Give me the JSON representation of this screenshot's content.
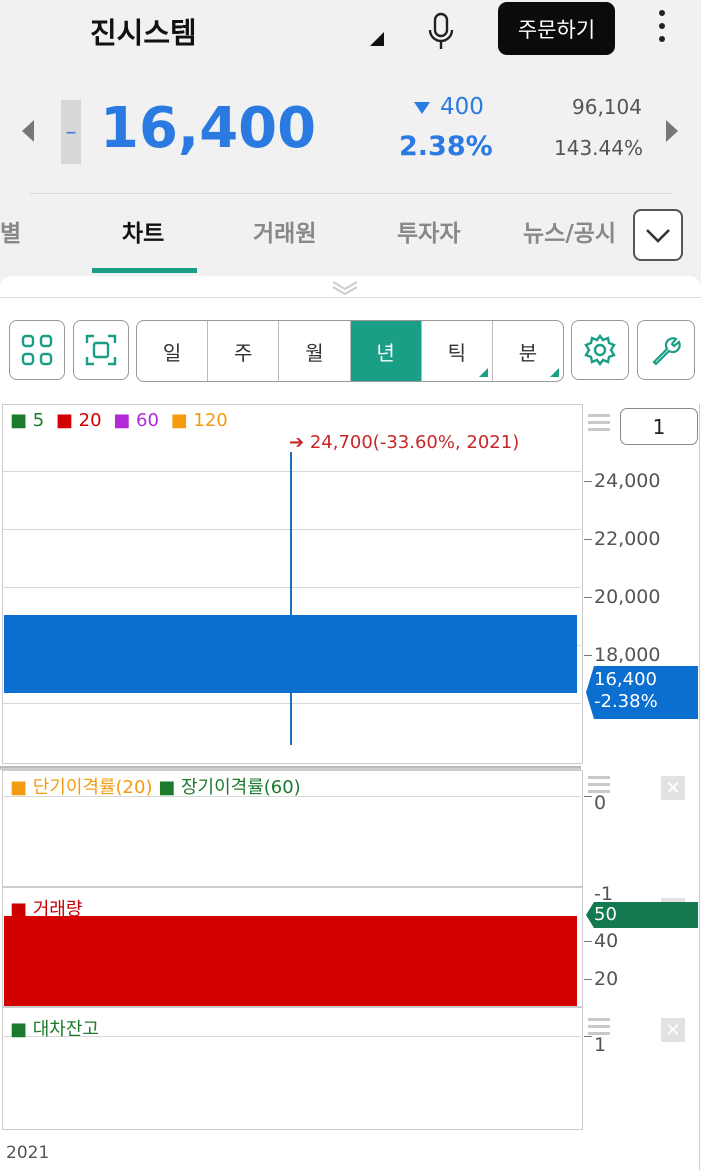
{
  "header": {
    "stock_name": "진시스템",
    "order_button": "주문하기"
  },
  "quote": {
    "flat_mark": "–",
    "price": "16,400",
    "change_amount": "400",
    "change_percent": "2.38%",
    "volume": "96,104",
    "volume_ratio": "143.44%"
  },
  "tabs": [
    "별",
    "차트",
    "거래원",
    "투자자",
    "뉴스/공시"
  ],
  "periods": [
    "일",
    "주",
    "월",
    "년",
    "틱",
    "분"
  ],
  "active_period": "년",
  "chart": {
    "legend": [
      {
        "label": "5",
        "color": "#1b7a2c"
      },
      {
        "label": "20",
        "color": "#d20000"
      },
      {
        "label": "60",
        "color": "#b22ad8"
      },
      {
        "label": "120",
        "color": "#f39c12"
      }
    ],
    "annotation": "24,700(-33.60%, 2021)",
    "y_ticks": [
      "24,000",
      "22,000",
      "20,000",
      "18,000"
    ],
    "scale_value": "1",
    "current_price": "16,400",
    "current_change": "-2.38%"
  },
  "chart_data": {
    "type": "bar",
    "categories": [
      "2021"
    ],
    "candles": [
      {
        "x": "2021",
        "high": 24700,
        "low": 16000,
        "open": 19200,
        "close": 16400
      }
    ],
    "ylim": [
      16000,
      25000
    ]
  },
  "oscillator": {
    "short_label": "단기이격률(20)",
    "long_label": "장기이격률(60)",
    "y_tick": "0",
    "y_tick_bottom": "-1"
  },
  "volume_panel": {
    "label": "거래량",
    "y_ticks": [
      "40",
      "20"
    ],
    "current": "50"
  },
  "loan_panel": {
    "label": "대차잔고",
    "y_tick": "1"
  },
  "x_axis": {
    "label": "2021"
  },
  "icons": [
    "mic-icon",
    "more-icon",
    "grid-icon",
    "fullscreen-icon",
    "gear-icon",
    "wrench-icon",
    "chevron-down-icon",
    "close-icon",
    "menu-icon"
  ]
}
